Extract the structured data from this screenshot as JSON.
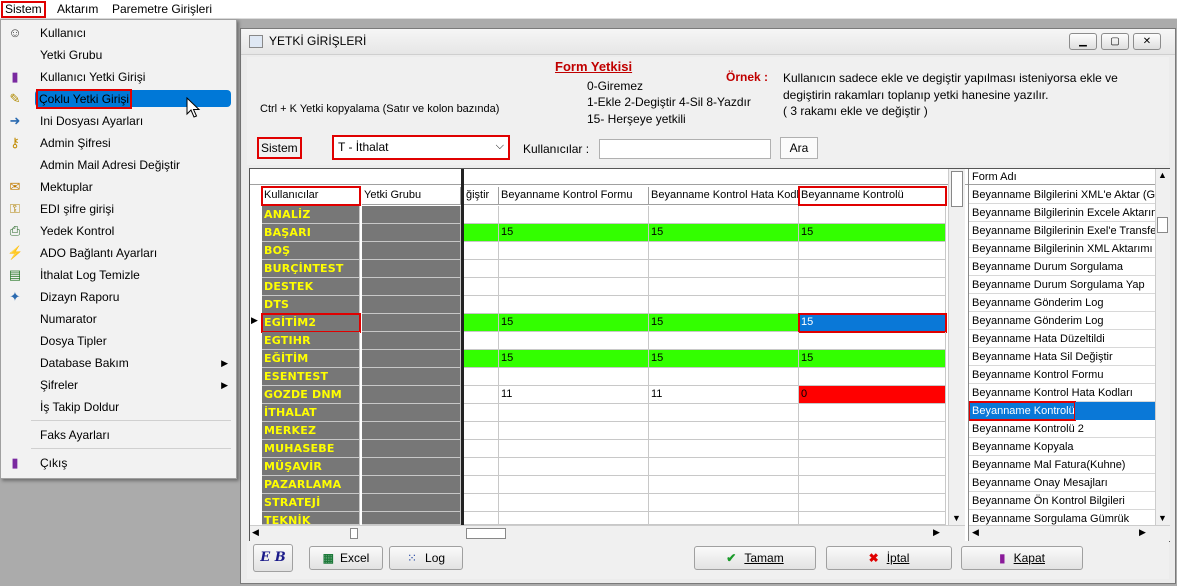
{
  "menubar": {
    "items": [
      "Sistem",
      "Aktarım",
      "Paremetre Girişleri"
    ]
  },
  "menu": {
    "items": [
      {
        "label": "Kullanıcı",
        "icon": "user-icon"
      },
      {
        "label": "Yetki Grubu",
        "icon": ""
      },
      {
        "label": "Kullanıcı Yetki Girişi",
        "icon": "user-permission-icon"
      },
      {
        "label": "Çoklu Yetki Girişi",
        "icon": "multi-permission-icon"
      },
      {
        "label": "Ini Dosyası  Ayarları",
        "icon": "ini-file-icon"
      },
      {
        "label": "Admin Şifresi",
        "icon": "key-icon"
      },
      {
        "label": "Admin Mail Adresi Değiştir",
        "icon": ""
      },
      {
        "label": "Mektuplar",
        "icon": "letters-icon"
      },
      {
        "label": "EDI şifre girişi",
        "icon": "edi-key-icon"
      },
      {
        "label": "Yedek Kontrol",
        "icon": "backup-icon"
      },
      {
        "label": "ADO Bağlantı Ayarları",
        "icon": "connection-icon"
      },
      {
        "label": "İthalat Log Temizle",
        "icon": "log-clean-icon"
      },
      {
        "label": "Dizayn Raporu",
        "icon": "design-report-icon"
      },
      {
        "label": "Numarator",
        "icon": ""
      },
      {
        "label": "Dosya Tipler",
        "icon": ""
      },
      {
        "label": "Database Bakım",
        "icon": "",
        "submenu": true
      },
      {
        "label": "Şifreler",
        "icon": "",
        "submenu": true
      },
      {
        "label": "İş Takip Doldur",
        "icon": ""
      },
      {
        "label": "Faks Ayarları",
        "icon": ""
      },
      {
        "label": "Çıkış",
        "icon": "exit-icon"
      }
    ]
  },
  "window": {
    "title": "YETKİ GİRİŞLERİ",
    "form_yetkisi_title": "Form Yetkisi",
    "legend_line1": "0-Giremez",
    "legend_line2": "1-Ekle  2-Degiştir  4-Sil  8-Yazdır",
    "legend_line3": "15- Herşeye yetkili",
    "ornek_label": "Örnek :",
    "ornek_text1": "Kullanıcın sadece ekle ve degiştir yapılması isteniyorsa  ekle ve",
    "ornek_text2": "degiştirin rakamları toplanıp yetki hanesine yazılır.",
    "ornek_text3": " ( 3 rakamı ekle ve değiştir )",
    "copy_hint": "Ctrl + K Yetki kopyalama (Satır ve kolon bazında)",
    "sistem_label": "Sistem",
    "sistem_value": "T - İthalat",
    "kullanicilar_label": "Kullanıcılar :",
    "kullanicilar_value": "",
    "ara_button": "Ara"
  },
  "grid": {
    "headers": [
      "Kullanıcılar",
      "Yetki Grubu",
      "ğiştir",
      "Beyanname Kontrol Formu",
      "Beyanname Kontrol Hata Kodları",
      "Beyanname Kontrolü"
    ],
    "rows": [
      {
        "name": "ANALİZ",
        "v": [
          "",
          "",
          ""
        ],
        "color": ""
      },
      {
        "name": "BAŞARI",
        "v": [
          "15",
          "15",
          "15"
        ],
        "color": "green"
      },
      {
        "name": "BOŞ",
        "v": [
          "",
          "",
          ""
        ],
        "color": ""
      },
      {
        "name": "BURÇİNTEST",
        "v": [
          "",
          "",
          ""
        ],
        "color": ""
      },
      {
        "name": "DESTEK",
        "v": [
          "",
          "",
          ""
        ],
        "color": ""
      },
      {
        "name": "DTS",
        "v": [
          "",
          "",
          ""
        ],
        "color": ""
      },
      {
        "name": "EGİTİM2",
        "v": [
          "15",
          "15",
          "15"
        ],
        "color": "green",
        "selected": true
      },
      {
        "name": "EGTIHR",
        "v": [
          "",
          "",
          ""
        ],
        "color": ""
      },
      {
        "name": "EĞİTİM",
        "v": [
          "15",
          "15",
          "15"
        ],
        "color": "green"
      },
      {
        "name": "ESENTEST",
        "v": [
          "",
          "",
          ""
        ],
        "color": ""
      },
      {
        "name": "GOZDE DNM",
        "v": [
          "11",
          "11",
          "0"
        ],
        "color": "red"
      },
      {
        "name": "İTHALAT",
        "v": [
          "",
          "",
          ""
        ],
        "color": ""
      },
      {
        "name": "MERKEZ",
        "v": [
          "",
          "",
          ""
        ],
        "color": ""
      },
      {
        "name": "MUHASEBE",
        "v": [
          "",
          "",
          ""
        ],
        "color": ""
      },
      {
        "name": "MÜŞAVİR",
        "v": [
          "",
          "",
          ""
        ],
        "color": ""
      },
      {
        "name": "PAZARLAMA",
        "v": [
          "",
          "",
          ""
        ],
        "color": ""
      },
      {
        "name": "STRATEJİ",
        "v": [
          "",
          "",
          ""
        ],
        "color": ""
      },
      {
        "name": "TEKNİK",
        "v": [
          "",
          "",
          ""
        ],
        "color": ""
      }
    ]
  },
  "forms": {
    "header": "Form Adı",
    "items": [
      "Beyanname Bilgilerini XML'e Aktar (GEN",
      "Beyanname Bilgilerinin Excele Aktarımı",
      "Beyanname Bilgilerinin Exel'e Transferi",
      "Beyanname Bilgilerinin XML Aktarımı (K",
      "Beyanname Durum Sorgulama",
      "Beyanname Durum Sorgulama Yap",
      "Beyanname Gönderim Log",
      "Beyanname Gönderim Log",
      "Beyanname Hata Düzeltildi",
      "Beyanname Hata Sil Değiştir",
      "Beyanname Kontrol Formu",
      "Beyanname Kontrol Hata Kodları",
      "Beyanname Kontrolü",
      "Beyanname Kontrolü 2",
      "Beyanname Kopyala",
      "Beyanname Mal Fatura(Kuhne)",
      "Beyanname Onay Mesajları",
      "Beyanname Ön Kontrol Bilgileri",
      "Beyanname Sorgulama Gümrük"
    ],
    "selected_index": 12
  },
  "buttons": {
    "logo": "E B",
    "excel": "Excel",
    "log": "Log",
    "tamam": "Tamam",
    "iptal": "İptal",
    "kapat": "Kapat"
  }
}
